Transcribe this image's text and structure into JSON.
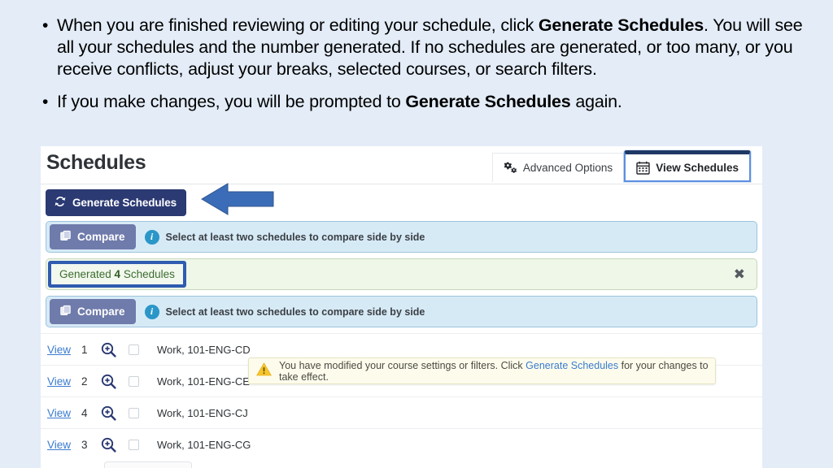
{
  "slide": {
    "bullets": [
      {
        "segments": [
          {
            "t": "When you are finished reviewing or editing your schedule, click ",
            "b": false
          },
          {
            "t": "Generate Schedules",
            "b": true
          },
          {
            "t": ". You will see all your schedules and the number generated. If no schedules are generated, or too many, or you receive conflicts, adjust your breaks, selected courses, or search filters.",
            "b": false
          }
        ]
      },
      {
        "segments": [
          {
            "t": "If you make changes, you will be prompted to ",
            "b": false
          },
          {
            "t": "Generate Schedules",
            "b": true
          },
          {
            "t": " again.",
            "b": false
          }
        ]
      }
    ],
    "annotation": {
      "shape": "left-arrow",
      "color": "#3b6cb7"
    }
  },
  "app": {
    "title": "Schedules",
    "tabs": [
      {
        "label": "Advanced Options",
        "icon": "gears-icon",
        "active": false
      },
      {
        "label": "View Schedules",
        "icon": "calendar-icon",
        "active": true
      }
    ],
    "generate_button": {
      "label": "Generate Schedules",
      "icon": "refresh-icon",
      "color": "#2b3a73"
    },
    "compare_bars": [
      {
        "button_label": "Compare",
        "icon": "copy-icon",
        "message": "Select at least two schedules to compare side by side",
        "info_icon": "info-circle-icon"
      },
      {
        "button_label": "Compare",
        "icon": "copy-icon",
        "message": "Select at least two schedules to compare side by side",
        "info_icon": "info-circle-icon"
      }
    ],
    "generated_bar": {
      "prefix": "Generated ",
      "count": "4",
      "suffix": " Schedules",
      "close_label": "✖"
    },
    "warning": {
      "icon": "warning-triangle-icon",
      "text_before": "You have modified your course settings or filters. Click ",
      "link": "Generate Schedules",
      "text_after": " for your changes to take effect."
    },
    "schedule_rows": [
      {
        "view": "View",
        "number": "1",
        "magnifier": "zoom-in-icon",
        "checked": false,
        "label": "Work, 101-ENG-CD"
      },
      {
        "view": "View",
        "number": "2",
        "magnifier": "zoom-in-icon",
        "checked": false,
        "label": "Work, 101-ENG-CE"
      },
      {
        "view": "View",
        "number": "4",
        "magnifier": "zoom-in-icon",
        "checked": false,
        "label": "Work, 101-ENG-CJ"
      },
      {
        "view": "View",
        "number": "3",
        "magnifier": "zoom-in-icon",
        "checked": false,
        "label": "Work, 101-ENG-CG"
      }
    ]
  },
  "colors": {
    "slide_bg": "#e3ecf7",
    "primary_navy": "#2b3a73",
    "link_blue": "#3a7bd0",
    "compare_bar": "#d6eaf6",
    "generated_bar": "#eef7e8",
    "warning_bg": "#fdfcec",
    "arrow": "#3b6cb7"
  }
}
